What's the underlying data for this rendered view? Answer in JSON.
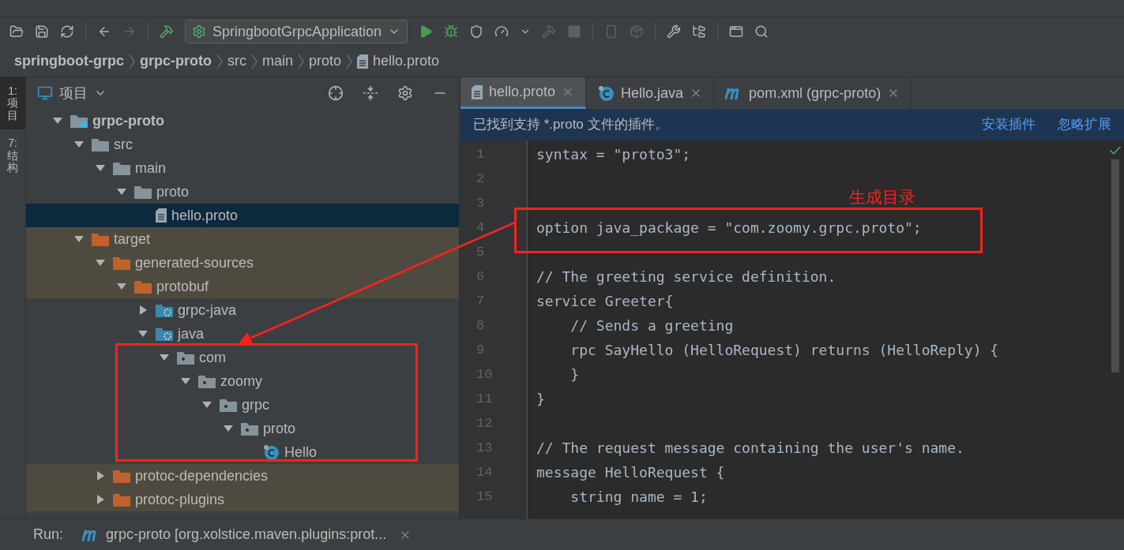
{
  "toolbar": {
    "run_config": "SpringbootGrpcApplication"
  },
  "breadcrumb": [
    {
      "label": "springboot-grpc",
      "kind": "module"
    },
    {
      "label": "grpc-proto",
      "kind": "module"
    },
    {
      "label": "src",
      "kind": "dir"
    },
    {
      "label": "main",
      "kind": "dir"
    },
    {
      "label": "proto",
      "kind": "dir"
    },
    {
      "label": "hello.proto",
      "kind": "file"
    }
  ],
  "side_tabs": [
    {
      "label": "1: 项目",
      "selected": true
    },
    {
      "label": "7: 结构",
      "selected": false
    }
  ],
  "project": {
    "title": "项目",
    "tree": [
      {
        "name": "grpc-proto",
        "kind": "module",
        "expanded": true,
        "selected": false,
        "excluded": false,
        "children": [
          {
            "name": "src",
            "kind": "folder",
            "expanded": true,
            "selected": false,
            "excluded": false,
            "children": [
              {
                "name": "main",
                "kind": "folder",
                "expanded": true,
                "selected": false,
                "excluded": false,
                "children": [
                  {
                    "name": "proto",
                    "kind": "folder",
                    "expanded": true,
                    "selected": false,
                    "excluded": false,
                    "children": [
                      {
                        "name": "hello.proto",
                        "kind": "file",
                        "selected": true,
                        "excluded": false
                      }
                    ]
                  }
                ]
              }
            ]
          },
          {
            "name": "target",
            "kind": "folder",
            "expanded": true,
            "selected": false,
            "excluded": true,
            "children": [
              {
                "name": "generated-sources",
                "kind": "folder",
                "expanded": true,
                "selected": false,
                "excluded": true,
                "children": [
                  {
                    "name": "protobuf",
                    "kind": "folder",
                    "expanded": true,
                    "selected": false,
                    "excluded": true,
                    "children": [
                      {
                        "name": "grpc-java",
                        "kind": "source",
                        "expanded": false,
                        "selected": false,
                        "excluded": false
                      },
                      {
                        "name": "java",
                        "kind": "source",
                        "expanded": true,
                        "selected": false,
                        "excluded": false,
                        "children": [
                          {
                            "name": "com",
                            "kind": "package",
                            "expanded": true,
                            "selected": false,
                            "excluded": false,
                            "children": [
                              {
                                "name": "zoomy",
                                "kind": "package",
                                "expanded": true,
                                "selected": false,
                                "excluded": false,
                                "children": [
                                  {
                                    "name": "grpc",
                                    "kind": "package",
                                    "expanded": true,
                                    "selected": false,
                                    "excluded": false,
                                    "children": [
                                      {
                                        "name": "proto",
                                        "kind": "package",
                                        "expanded": true,
                                        "selected": false,
                                        "excluded": false,
                                        "children": [
                                          {
                                            "name": "Hello",
                                            "kind": "class",
                                            "selected": false,
                                            "excluded": false
                                          }
                                        ]
                                      }
                                    ]
                                  }
                                ]
                              }
                            ]
                          }
                        ]
                      }
                    ]
                  }
                ]
              },
              {
                "name": "protoc-dependencies",
                "kind": "folder",
                "expanded": false,
                "selected": false,
                "excluded": true
              },
              {
                "name": "protoc-plugins",
                "kind": "folder",
                "expanded": false,
                "selected": false,
                "excluded": true
              }
            ]
          }
        ]
      }
    ]
  },
  "tabs": [
    {
      "label": "hello.proto",
      "kind": "file",
      "selected": true
    },
    {
      "label": "Hello.java",
      "kind": "class",
      "selected": false
    },
    {
      "label": "pom.xml (grpc-proto)",
      "kind": "maven",
      "selected": false
    }
  ],
  "notification": {
    "message": "已找到支持 *.proto 文件的插件。",
    "actions": [
      "安装插件",
      "忽略扩展"
    ]
  },
  "code": [
    {
      "number": "1",
      "text": "syntax = \"proto3\";"
    },
    {
      "number": "2"
    },
    {
      "number": "3"
    },
    {
      "number": "4",
      "text": "option java_package = \"com.zoomy.grpc.proto\";"
    },
    {
      "number": "5"
    },
    {
      "number": "6",
      "text": "// The greeting service definition."
    },
    {
      "number": "7",
      "text": "service Greeter{"
    },
    {
      "number": "8",
      "text": "    // Sends a greeting"
    },
    {
      "number": "9",
      "text": "    rpc SayHello (HelloRequest) returns (HelloReply) {"
    },
    {
      "number": "10",
      "text": "    }"
    },
    {
      "number": "11",
      "text": "}"
    },
    {
      "number": "12"
    },
    {
      "number": "13",
      "text": "// The request message containing the user's name."
    },
    {
      "number": "14",
      "text": "message HelloRequest {"
    },
    {
      "number": "15",
      "text": "    string name = 1;"
    }
  ],
  "annotation": {
    "label": "生成目录"
  },
  "run_bar": {
    "label": "Run:",
    "tab": "grpc-proto [org.xolstice.maven.plugins:prot..."
  }
}
